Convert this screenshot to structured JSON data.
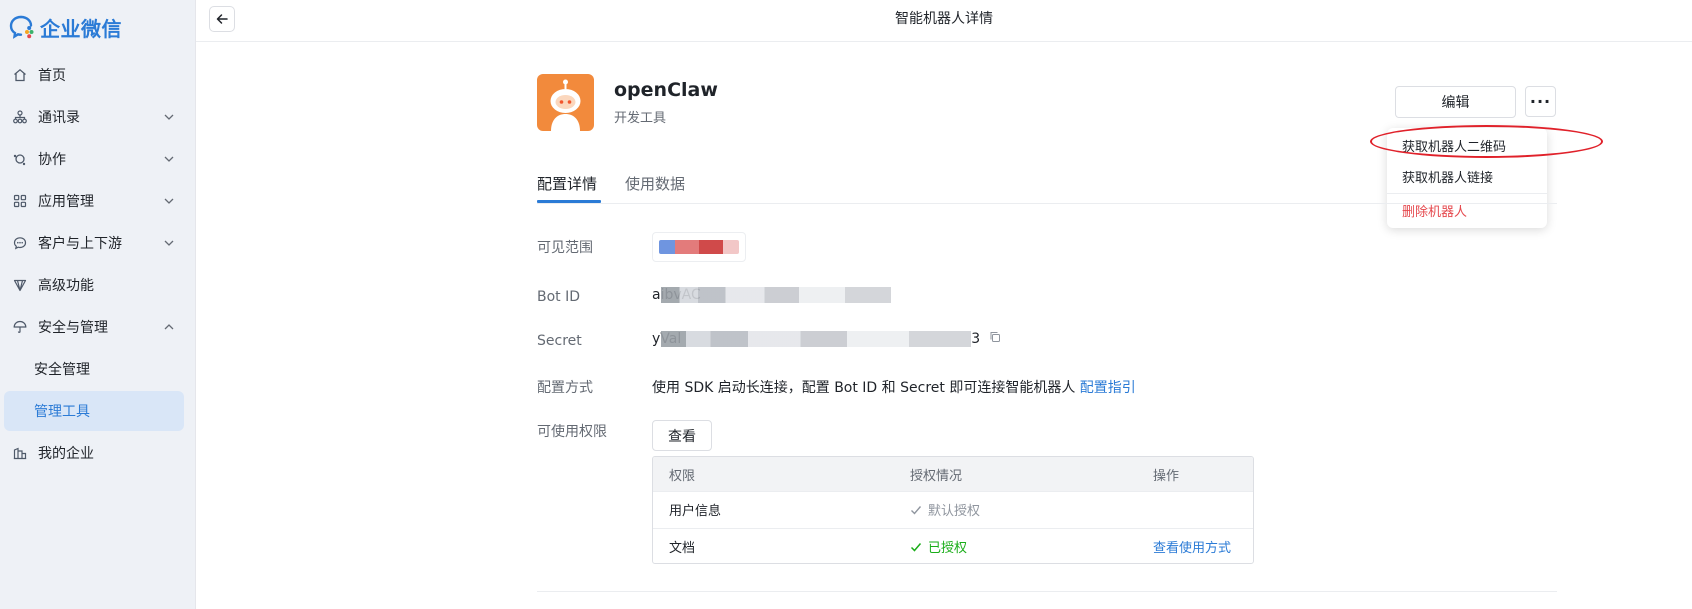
{
  "brand": {
    "name": "企业微信"
  },
  "sidebar": {
    "items": [
      {
        "label": "首页",
        "icon": "home-icon"
      },
      {
        "label": "通讯录",
        "icon": "org-chart-icon",
        "expandable": true
      },
      {
        "label": "协作",
        "icon": "collab-icon",
        "expandable": true
      },
      {
        "label": "应用管理",
        "icon": "apps-grid-icon",
        "expandable": true
      },
      {
        "label": "客户与上下游",
        "icon": "chat-bubble-icon",
        "expandable": true
      },
      {
        "label": "高级功能",
        "icon": "diamond-icon"
      },
      {
        "label": "安全与管理",
        "icon": "umbrella-icon",
        "expanded": true
      },
      {
        "label": "安全管理",
        "sub": true
      },
      {
        "label": "管理工具",
        "sub": true,
        "active": true
      },
      {
        "label": "我的企业",
        "icon": "building-icon"
      }
    ]
  },
  "header": {
    "title": "智能机器人详情"
  },
  "bot": {
    "name": "openClaw",
    "type": "开发工具"
  },
  "actions": {
    "edit_label": "编辑",
    "more_label": "···"
  },
  "menu": {
    "items": [
      "获取机器人二维码",
      "获取机器人链接",
      "删除机器人"
    ]
  },
  "tabs": [
    "配置详情",
    "使用数据"
  ],
  "fields": {
    "visible_label": "可见范围",
    "botid_label": "Bot ID",
    "botid_prefix": "aibvAC",
    "secret_label": "Secret",
    "secret_prefix": "yVal",
    "secret_suffix": "3",
    "config_label": "配置方式",
    "config_text": "使用 SDK 启动长连接，配置 Bot ID 和 Secret 即可连接智能机器人",
    "config_link": "配置指引",
    "perm_label": "可使用权限",
    "view_label": "查看"
  },
  "permissions": {
    "headers": [
      "权限",
      "授权情况",
      "操作"
    ],
    "rows": [
      {
        "name": "用户信息",
        "status": "默认授权",
        "action": ""
      },
      {
        "name": "文档",
        "status": "已授权",
        "action": "查看使用方式"
      }
    ]
  },
  "colors": {
    "accent": "#2b7bd6",
    "success": "#1aad19",
    "danger": "#e5484d",
    "annotation": "#e0212a",
    "avatar": "#f28a3c"
  }
}
